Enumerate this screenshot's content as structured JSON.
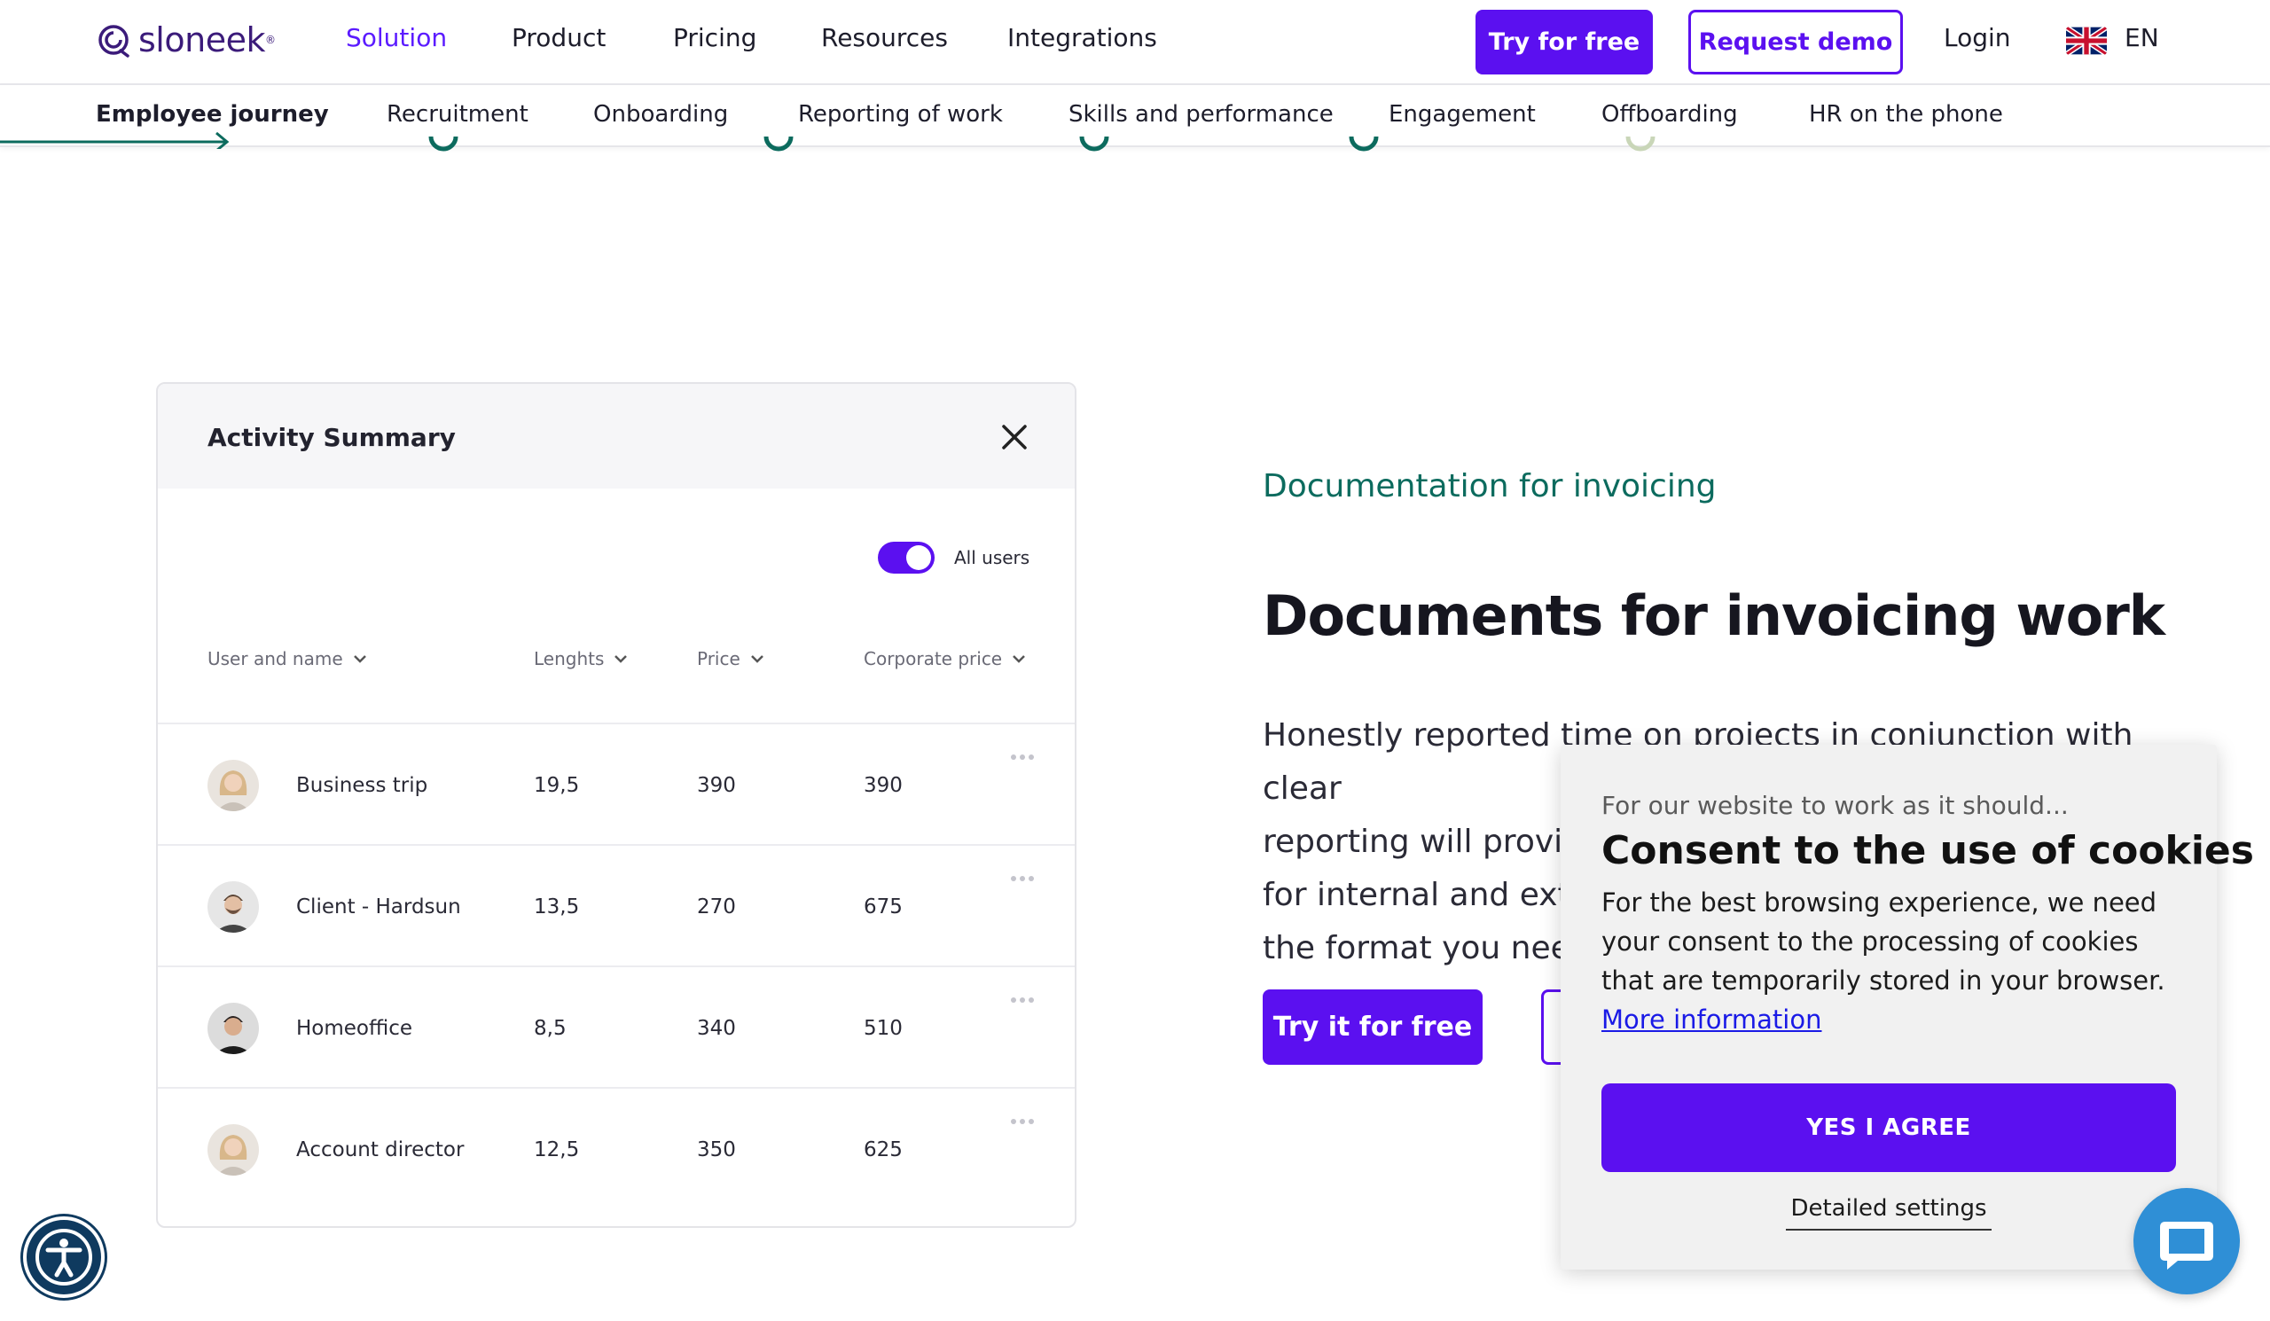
{
  "header": {
    "logo_text": "sloneek",
    "logo_mark": "®",
    "menu": [
      {
        "label": "Solution"
      },
      {
        "label": "Product"
      },
      {
        "label": "Pricing"
      },
      {
        "label": "Resources"
      },
      {
        "label": "Integrations"
      }
    ],
    "try_label": "Try for free",
    "demo_label": "Request demo",
    "login_label": "Login",
    "flag_icon": "uk-flag-icon",
    "lang_label": "EN",
    "accent_color": "#5b10f0"
  },
  "subnav": {
    "items": [
      {
        "label": "Employee journey"
      },
      {
        "label": "Recruitment"
      },
      {
        "label": "Onboarding"
      },
      {
        "label": "Reporting of work"
      },
      {
        "label": "Skills and performance"
      },
      {
        "label": "Engagement"
      },
      {
        "label": "Offboarding"
      },
      {
        "label": "HR on the phone"
      }
    ]
  },
  "activity": {
    "title": "Activity Summary",
    "toggle_label": "All users",
    "toggle_on": true,
    "columns": [
      "User and name",
      "Lenghts",
      "Price",
      "Corporate price"
    ],
    "rows": [
      {
        "name": "Business trip",
        "length": "19,5",
        "price": "390",
        "corporate": "390",
        "avatar": "woman-blonde-avatar"
      },
      {
        "name": "Client - Hardsun",
        "length": "13,5",
        "price": "270",
        "corporate": "675",
        "avatar": "man-beard-avatar"
      },
      {
        "name": "Homeoffice",
        "length": "8,5",
        "price": "340",
        "corporate": "510",
        "avatar": "man-dark-avatar"
      },
      {
        "name": "Account director",
        "length": "12,5",
        "price": "350",
        "corporate": "625",
        "avatar": "woman-blonde-avatar"
      }
    ]
  },
  "content": {
    "kicker": "Documentation for invoicing",
    "headline": "Documents for invoicing work",
    "body_lines": [
      "Honestly reported time on projects in conjunction with clear",
      "reporting will provic",
      "for internal and exte",
      "the format you need"
    ],
    "cta_label": "Try it for free"
  },
  "cookie": {
    "kicker": "For our website to work as it should...",
    "title": "Consent to the use of cookies",
    "text": "For the best browsing experience, we need your consent to the processing of cookies that are temporarily stored in your browser. ",
    "link": "More information",
    "agree_label": "YES I AGREE",
    "settings_label": "Detailed settings"
  },
  "floating": {
    "accessibility_icon": "accessibility-icon",
    "chat_icon": "chat-bubble-icon"
  }
}
